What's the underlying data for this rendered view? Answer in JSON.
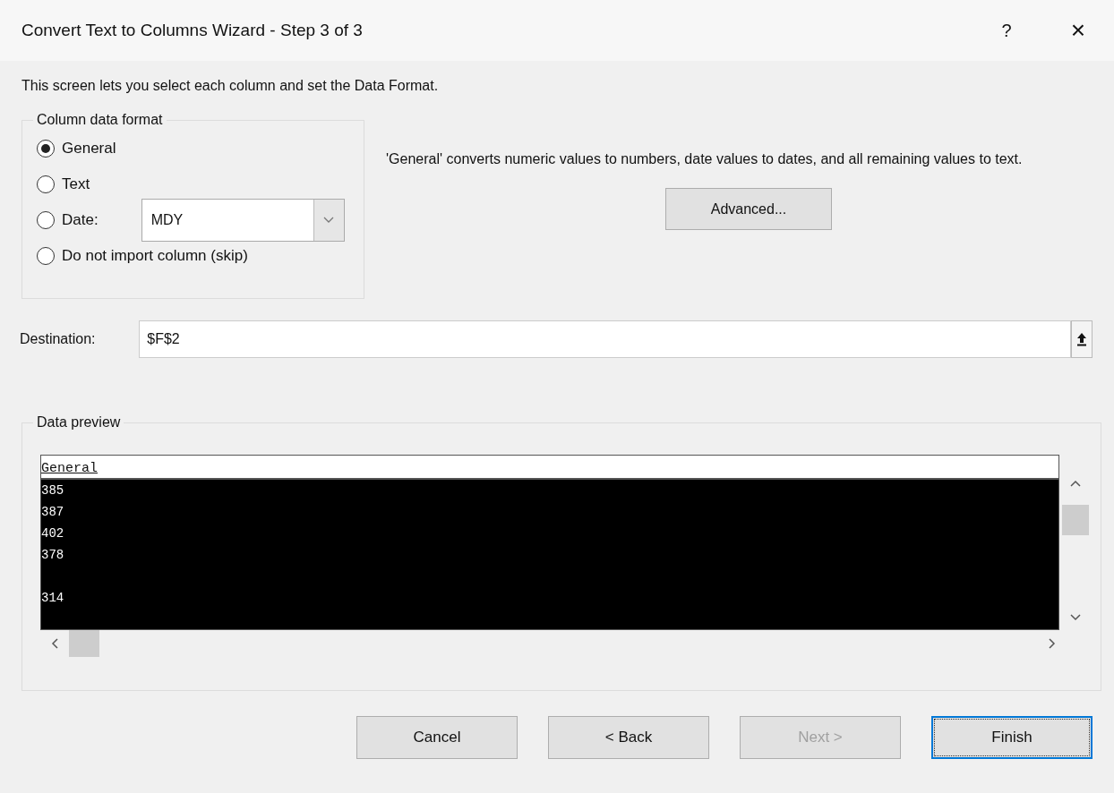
{
  "window": {
    "title": "Convert Text to Columns Wizard - Step 3 of 3",
    "help": "?",
    "close": "×"
  },
  "intro": "This screen lets you select each column and set the Data Format.",
  "column_data_format": {
    "legend": "Column data format",
    "options": [
      {
        "label": "General",
        "selected": true,
        "kind": "plain"
      },
      {
        "label": "Text",
        "selected": false,
        "kind": "plain"
      },
      {
        "label": "Date:",
        "selected": false,
        "kind": "select",
        "value": "MDY"
      },
      {
        "label": "Do not import column (skip)",
        "selected": false,
        "kind": "plain"
      }
    ]
  },
  "description": "'General' converts numeric values to numbers, date values to dates, and all remaining values to text.",
  "advanced_button": "Advanced...",
  "destination": {
    "label": "Destination:",
    "value": "$F$2"
  },
  "data_preview": {
    "legend": "Data preview",
    "columns": [
      {
        "header": "General",
        "selected": true,
        "rows": [
          [
            "385"
          ],
          [
            "387"
          ],
          [
            "402"
          ],
          [
            "378"
          ],
          [],
          [
            "314"
          ]
        ]
      }
    ]
  },
  "buttons": [
    {
      "label": "Cancel",
      "disabled": false,
      "default": false
    },
    {
      "label": "< Back",
      "disabled": false,
      "default": false
    },
    {
      "label": "Next >",
      "disabled": true,
      "default": false
    },
    {
      "label": "Finish",
      "disabled": false,
      "default": true
    }
  ]
}
